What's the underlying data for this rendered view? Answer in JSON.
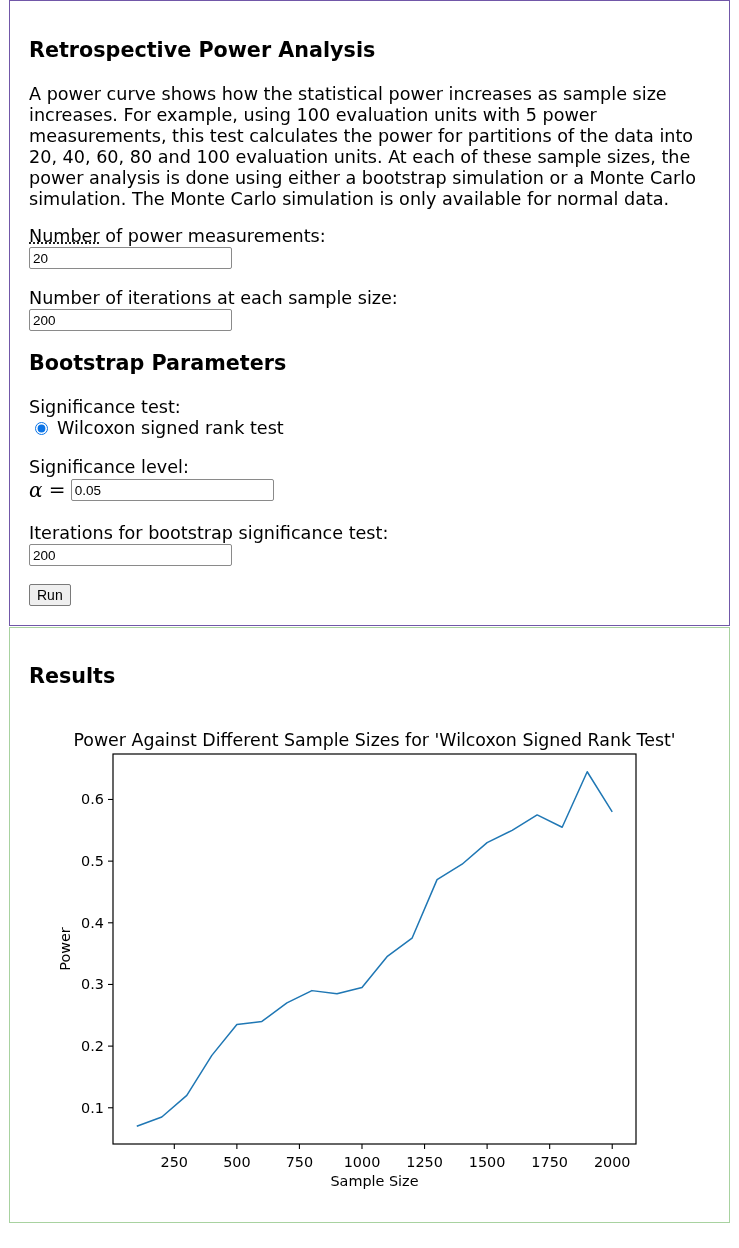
{
  "analysis": {
    "title": "Retrospective Power Analysis",
    "description": "A power curve shows how the statistical power increases as sample size increases. For example, using 100 evaluation units with 5 power measurements, this test calculates the power for partitions of the data into 20, 40, 60, 80 and 100 evaluation units. At each of these sample sizes, the power analysis is done using either a bootstrap simulation or a Monte Carlo simulation. The Monte Carlo simulation is only available for normal data.",
    "power_measurements": {
      "label_abbr": "Number",
      "label_rest": "of power measurements:",
      "value": "20"
    },
    "iterations": {
      "label": "Number of iterations at each sample size:",
      "value": "200"
    }
  },
  "bootstrap": {
    "title": "Bootstrap Parameters",
    "significance_test": {
      "label": "Significance test:",
      "options": [
        {
          "label": "Wilcoxon signed rank test",
          "selected": true
        }
      ]
    },
    "significance_level": {
      "label": "Significance level:",
      "symbol": "α =",
      "value": "0.05"
    },
    "bootstrap_iterations": {
      "label": "Iterations for bootstrap significance test:",
      "value": "200"
    },
    "run_button": "Run"
  },
  "results": {
    "title": "Results",
    "chart_data": {
      "type": "line",
      "title": "Power Against Different Sample Sizes for 'Wilcoxon Signed Rank Test'",
      "xlabel": "Sample Size",
      "ylabel": "Power",
      "x": [
        100,
        200,
        300,
        400,
        500,
        600,
        700,
        800,
        900,
        1000,
        1100,
        1200,
        1300,
        1400,
        1500,
        1600,
        1700,
        1800,
        1900,
        2000
      ],
      "series": [
        {
          "color": "#1f77b4",
          "values": [
            0.07,
            0.085,
            0.12,
            0.185,
            0.235,
            0.24,
            0.27,
            0.29,
            0.285,
            0.295,
            0.345,
            0.375,
            0.47,
            0.495,
            0.53,
            0.55,
            0.575,
            0.555,
            0.645,
            0.58
          ]
        }
      ],
      "xlim": [
        5,
        2095
      ],
      "ylim": [
        0.04125,
        0.67375
      ],
      "xticks": [
        250,
        500,
        750,
        1000,
        1250,
        1500,
        1750,
        2000
      ],
      "yticks": [
        0.1,
        0.2,
        0.3,
        0.4,
        0.5,
        0.6
      ]
    }
  }
}
